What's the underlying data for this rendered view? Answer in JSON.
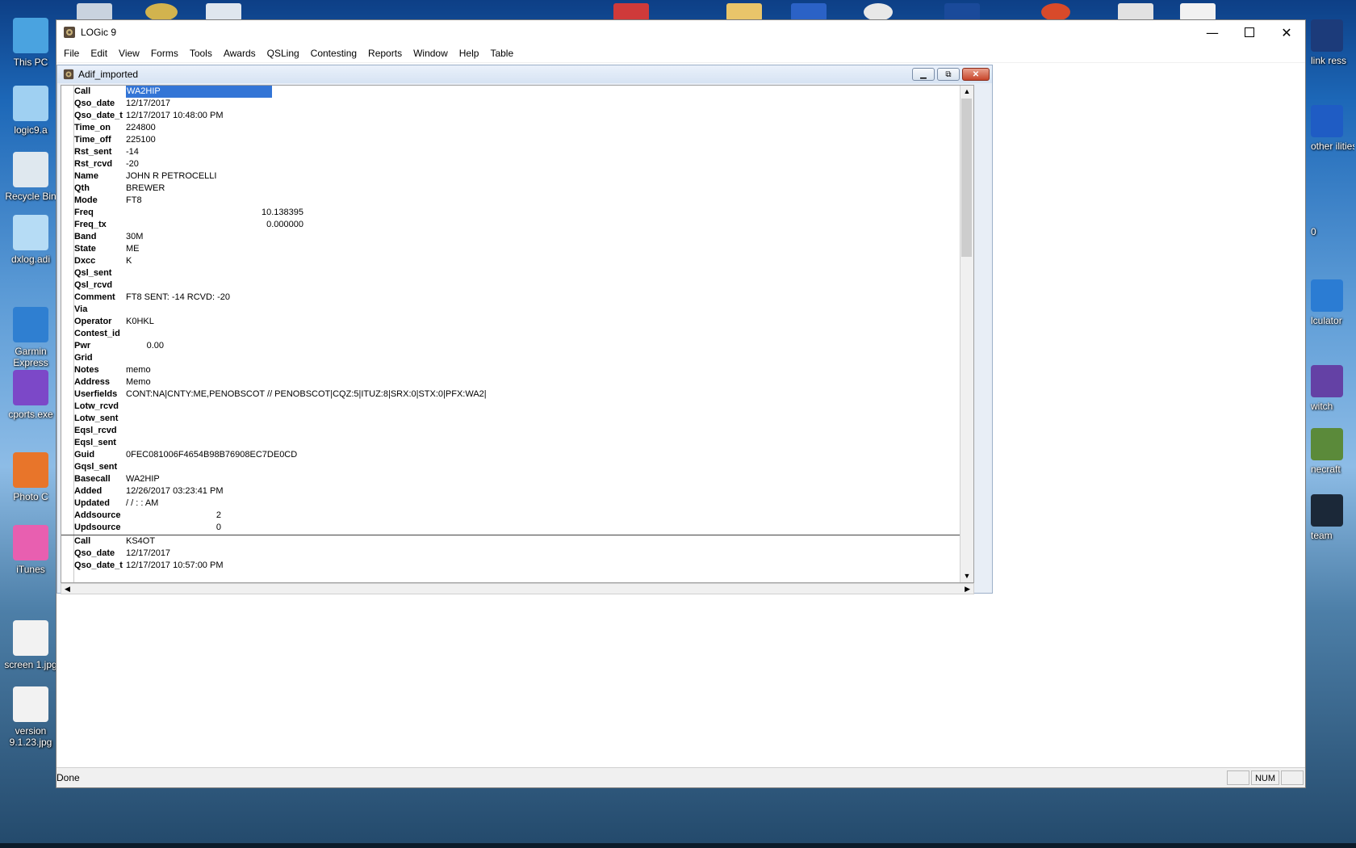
{
  "desktop": {
    "left_icons": [
      {
        "label": "This PC",
        "color": "#4aa3e0"
      },
      {
        "label": "logic9.a",
        "color": "#9fd0f2"
      },
      {
        "label": "Recycle Bin",
        "color": "#dfe8ef"
      },
      {
        "label": "dxlog.adi",
        "color": "#b6dcf5"
      },
      {
        "label": "Garmin Express",
        "color": "#2f7fd1"
      },
      {
        "label": "cports.exe",
        "color": "#7c48c8"
      },
      {
        "label": "Photo C",
        "color": "#e8752a"
      },
      {
        "label": "iTunes",
        "color": "#e85fb0"
      },
      {
        "label": "screen 1.jpg",
        "color": "#f2f2f2"
      },
      {
        "label": "version 9.1.23.jpg",
        "color": "#f2f2f2"
      }
    ],
    "right_icons": [
      {
        "label": "link ress",
        "color": "#1c3b7a"
      },
      {
        "label": "other ilities",
        "color": "#1f5cc4"
      },
      {
        "label": "0",
        "color": ""
      },
      {
        "label": "lculator",
        "color": "#2b7cd3"
      },
      {
        "label": "witch",
        "color": "#6441a5"
      },
      {
        "label": "necraft",
        "color": "#5b8a3a"
      },
      {
        "label": "team",
        "color": "#1b2838"
      }
    ]
  },
  "app": {
    "title": "LOGic 9",
    "menu": [
      "File",
      "Edit",
      "View",
      "Forms",
      "Tools",
      "Awards",
      "QSLing",
      "Contesting",
      "Reports",
      "Window",
      "Help",
      "Table"
    ],
    "status": "Done",
    "status_panels": [
      "",
      "NUM",
      ""
    ]
  },
  "child": {
    "title": "Adif_imported"
  },
  "records": [
    {
      "fields": [
        {
          "label": "Call",
          "value": "WA2HIP",
          "selected": true
        },
        {
          "label": "Qso_date",
          "value": "12/17/2017"
        },
        {
          "label": "Qso_date_t",
          "value": "12/17/2017 10:48:00 PM"
        },
        {
          "label": "Time_on",
          "value": "224800"
        },
        {
          "label": "Time_off",
          "value": "225100"
        },
        {
          "label": "Rst_sent",
          "value": "-14"
        },
        {
          "label": "Rst_rcvd",
          "value": "-20"
        },
        {
          "label": "Name",
          "value": "JOHN R PETROCELLI"
        },
        {
          "label": "Qth",
          "value": "BREWER"
        },
        {
          "label": "Mode",
          "value": "FT8"
        },
        {
          "label": "Freq",
          "value": "10.138395",
          "align": "num"
        },
        {
          "label": "Freq_tx",
          "value": "0.000000",
          "align": "num"
        },
        {
          "label": "Band",
          "value": "30M"
        },
        {
          "label": "State",
          "value": "ME"
        },
        {
          "label": "Dxcc",
          "value": "K"
        },
        {
          "label": "Qsl_sent",
          "value": ""
        },
        {
          "label": "Qsl_rcvd",
          "value": ""
        },
        {
          "label": "Comment",
          "value": "FT8  SENT: -14  RCVD: -20"
        },
        {
          "label": "Via",
          "value": ""
        },
        {
          "label": "Operator",
          "value": "K0HKL"
        },
        {
          "label": "Contest_id",
          "value": ""
        },
        {
          "label": "Pwr",
          "value": "0.00",
          "align": "pwr"
        },
        {
          "label": "Grid",
          "value": ""
        },
        {
          "label": "Notes",
          "value": "memo"
        },
        {
          "label": "Address",
          "value": "Memo"
        },
        {
          "label": "Userfields",
          "value": "CONT:NA|CNTY:ME,PENOBSCOT // PENOBSCOT|CQZ:5|ITUZ:8|SRX:0|STX:0|PFX:WA2|"
        },
        {
          "label": "Lotw_rcvd",
          "value": ""
        },
        {
          "label": "Lotw_sent",
          "value": ""
        },
        {
          "label": "Eqsl_rcvd",
          "value": ""
        },
        {
          "label": "Eqsl_sent",
          "value": ""
        },
        {
          "label": "Guid",
          "value": "0FEC081006F4654B98B76908EC7DE0CD"
        },
        {
          "label": "Gqsl_sent",
          "value": ""
        },
        {
          "label": "Basecall",
          "value": "WA2HIP"
        },
        {
          "label": "Added",
          "value": "12/26/2017 03:23:41 PM"
        },
        {
          "label": "Updated",
          "value": " /  /      :  :   AM"
        },
        {
          "label": "Addsource",
          "value": "2",
          "align": "int"
        },
        {
          "label": "Updsource",
          "value": "0",
          "align": "int"
        }
      ]
    },
    {
      "fields": [
        {
          "label": "Call",
          "value": "KS4OT"
        },
        {
          "label": "Qso_date",
          "value": "12/17/2017"
        },
        {
          "label": "Qso_date_t",
          "value": "12/17/2017 10:57:00 PM"
        }
      ]
    }
  ]
}
